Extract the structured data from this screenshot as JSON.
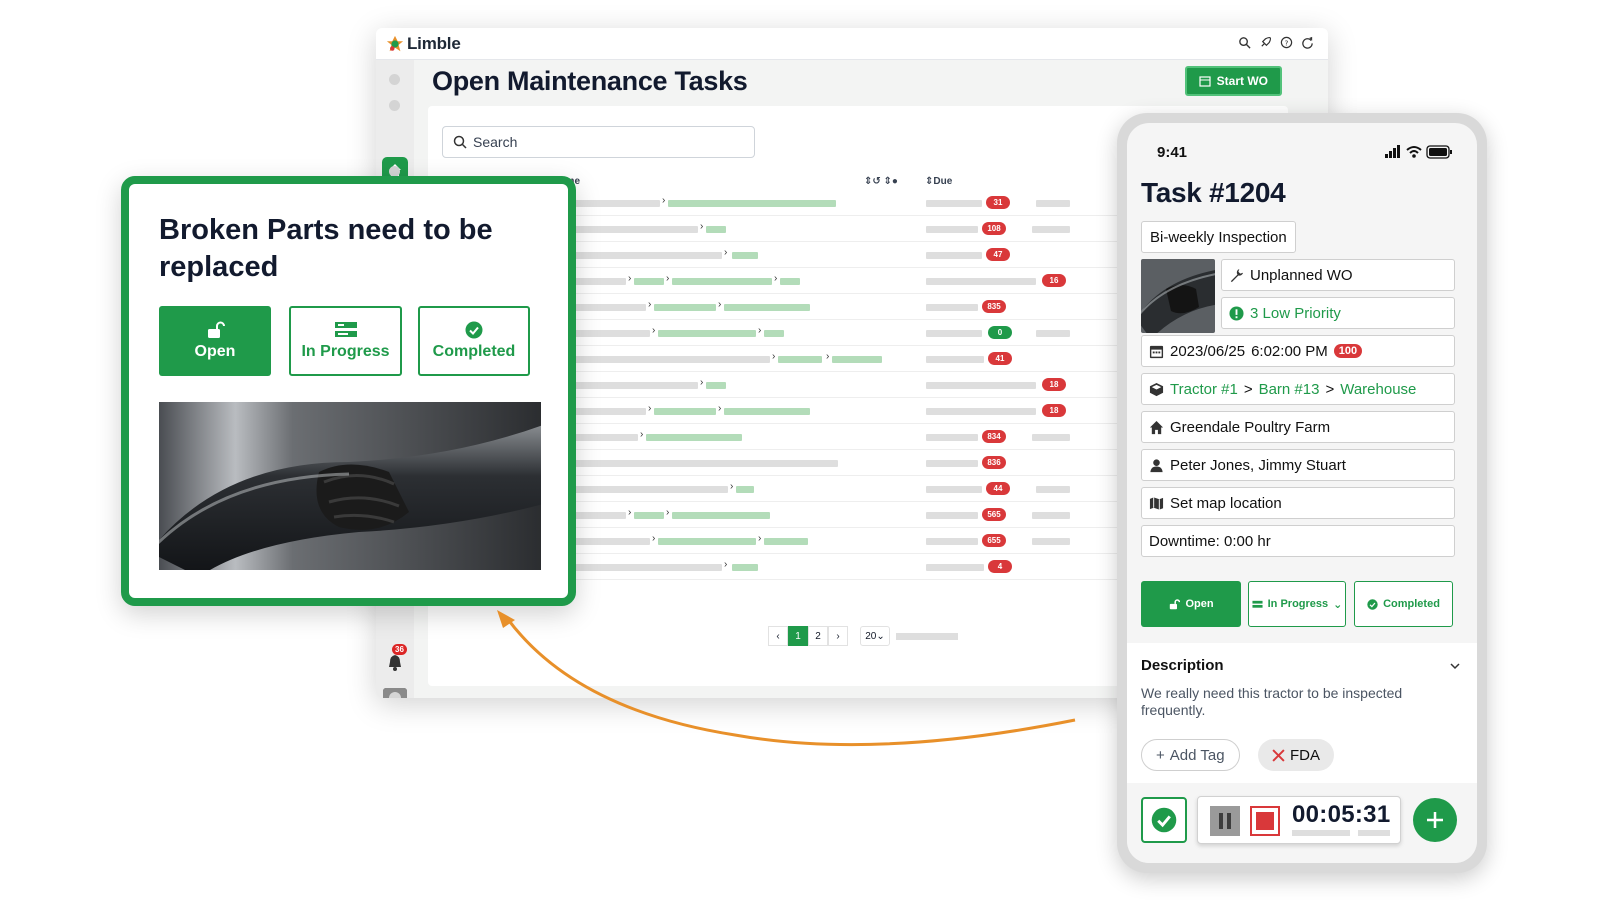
{
  "desktop": {
    "app_name": "Limble",
    "page_title": "Open Maintenance Tasks",
    "start_wo_label": "Start WO",
    "search": {
      "placeholder": "Search"
    },
    "columns": {
      "name": "ame",
      "due": "Due"
    },
    "notification_count": "36",
    "due_badges": [
      "31",
      "108",
      "47",
      "16",
      "835",
      "0",
      "41",
      "18",
      "18",
      "834",
      "836",
      "44",
      "565",
      "655",
      "4"
    ],
    "pagination": {
      "prev": "‹",
      "page1": "1",
      "page2": "2",
      "next": "›",
      "per_page": "20"
    }
  },
  "callout": {
    "title": "Broken Parts need to be replaced",
    "buttons": {
      "open": "Open",
      "in_progress": "In Progress",
      "completed": "Completed"
    }
  },
  "phone": {
    "time": "9:41",
    "task_title": "Task #1204",
    "template_tag": "Bi-weekly Inspection",
    "wo_type": "Unplanned WO",
    "priority": "3 Low Priority",
    "due_date": "2023/06/25",
    "due_time": "6:02:00 PM",
    "due_badge": "100",
    "asset_path": {
      "asset": "Tractor #1",
      "sep": ">",
      "parent": "Barn #13",
      "location": "Warehouse"
    },
    "location": "Greendale Poultry Farm",
    "assignees": "Peter Jones, Jimmy Stuart",
    "map": "Set map location",
    "downtime": "Downtime: 0:00 hr",
    "status_buttons": {
      "open": "Open",
      "in_progress": "In Progress",
      "completed": "Completed"
    },
    "description_label": "Description",
    "description_text": "We really need this tractor to be inspected frequently.",
    "add_tag": "Add Tag",
    "tag_fda": "FDA",
    "timer": "00:05:31"
  },
  "colors": {
    "brand_green": "#1f9a4a",
    "alert_red": "#d9383a",
    "arrow_orange": "#e8902a"
  }
}
